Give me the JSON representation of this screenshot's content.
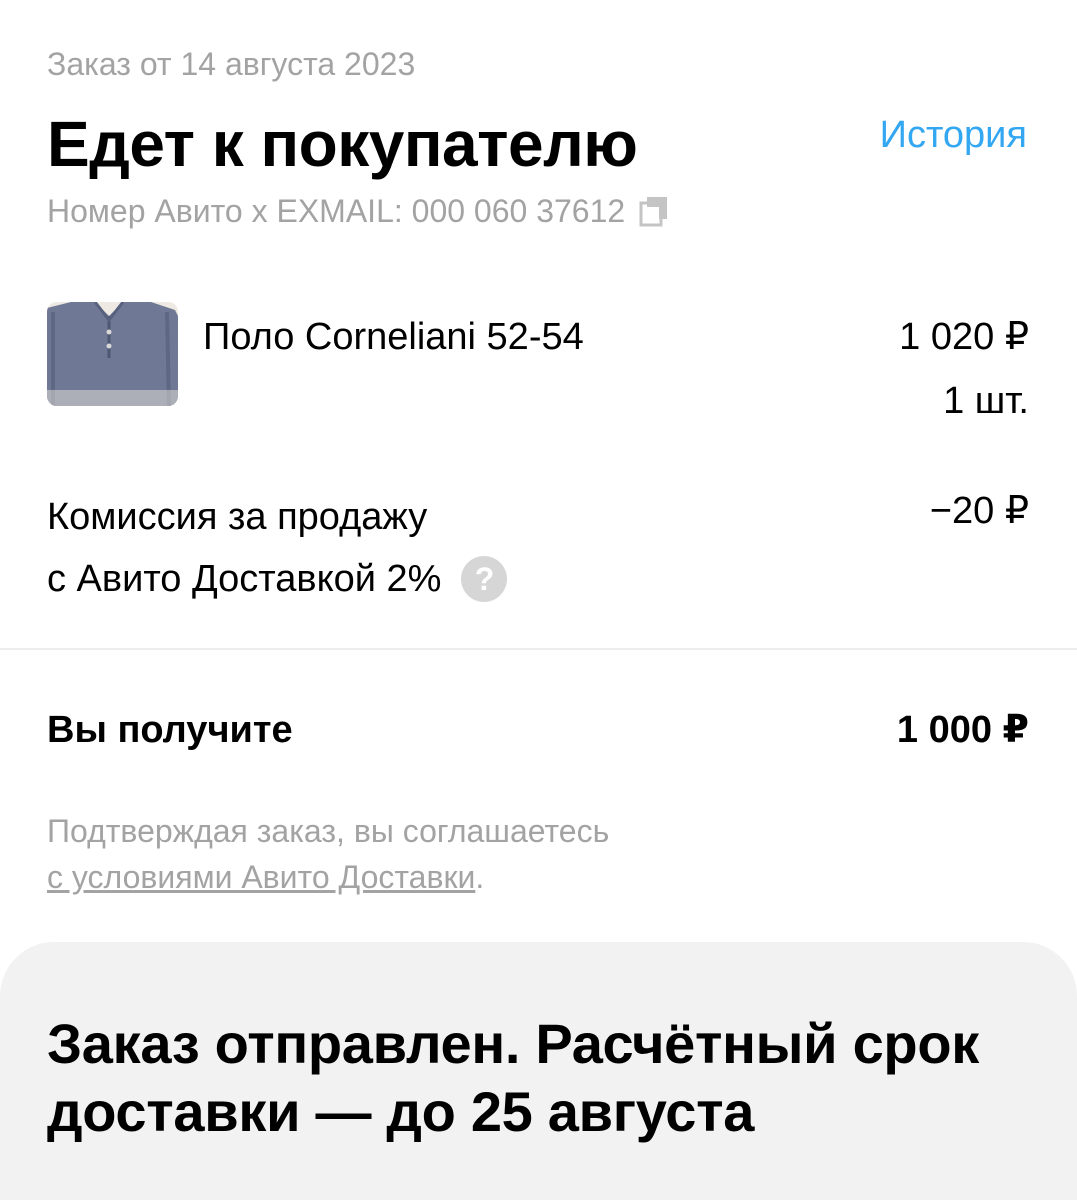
{
  "order": {
    "date_text": "Заказ от 14 августа 2023",
    "status": "Едет к покупателю",
    "history_link": "История",
    "tracking_text": "Номер Авито x EXMAIL: 000 060 37612"
  },
  "product": {
    "name": "Поло Corneliani 52-54",
    "price": "1 020 ₽",
    "quantity": "1 шт.",
    "thumbnail_icon": "polo-shirt-photo"
  },
  "commission": {
    "label_line1": "Комиссия за продажу",
    "label_line2": "с Авито Доставкой 2%",
    "help_glyph": "?",
    "value": "−20 ₽"
  },
  "total": {
    "label": "Вы получите",
    "value": "1 000 ₽"
  },
  "terms": {
    "line1": "Подтверждая заказ, вы соглашаетесь",
    "link_text": "с условиями Авито Доставки",
    "suffix": "."
  },
  "delivery_card": {
    "title": "Заказ отправлен. Расчётный срок доставки — до 25 августа"
  },
  "colors": {
    "accent_link": "#34a7f2",
    "muted_text": "#a3a3a3",
    "card_bg": "#f2f2f2"
  }
}
